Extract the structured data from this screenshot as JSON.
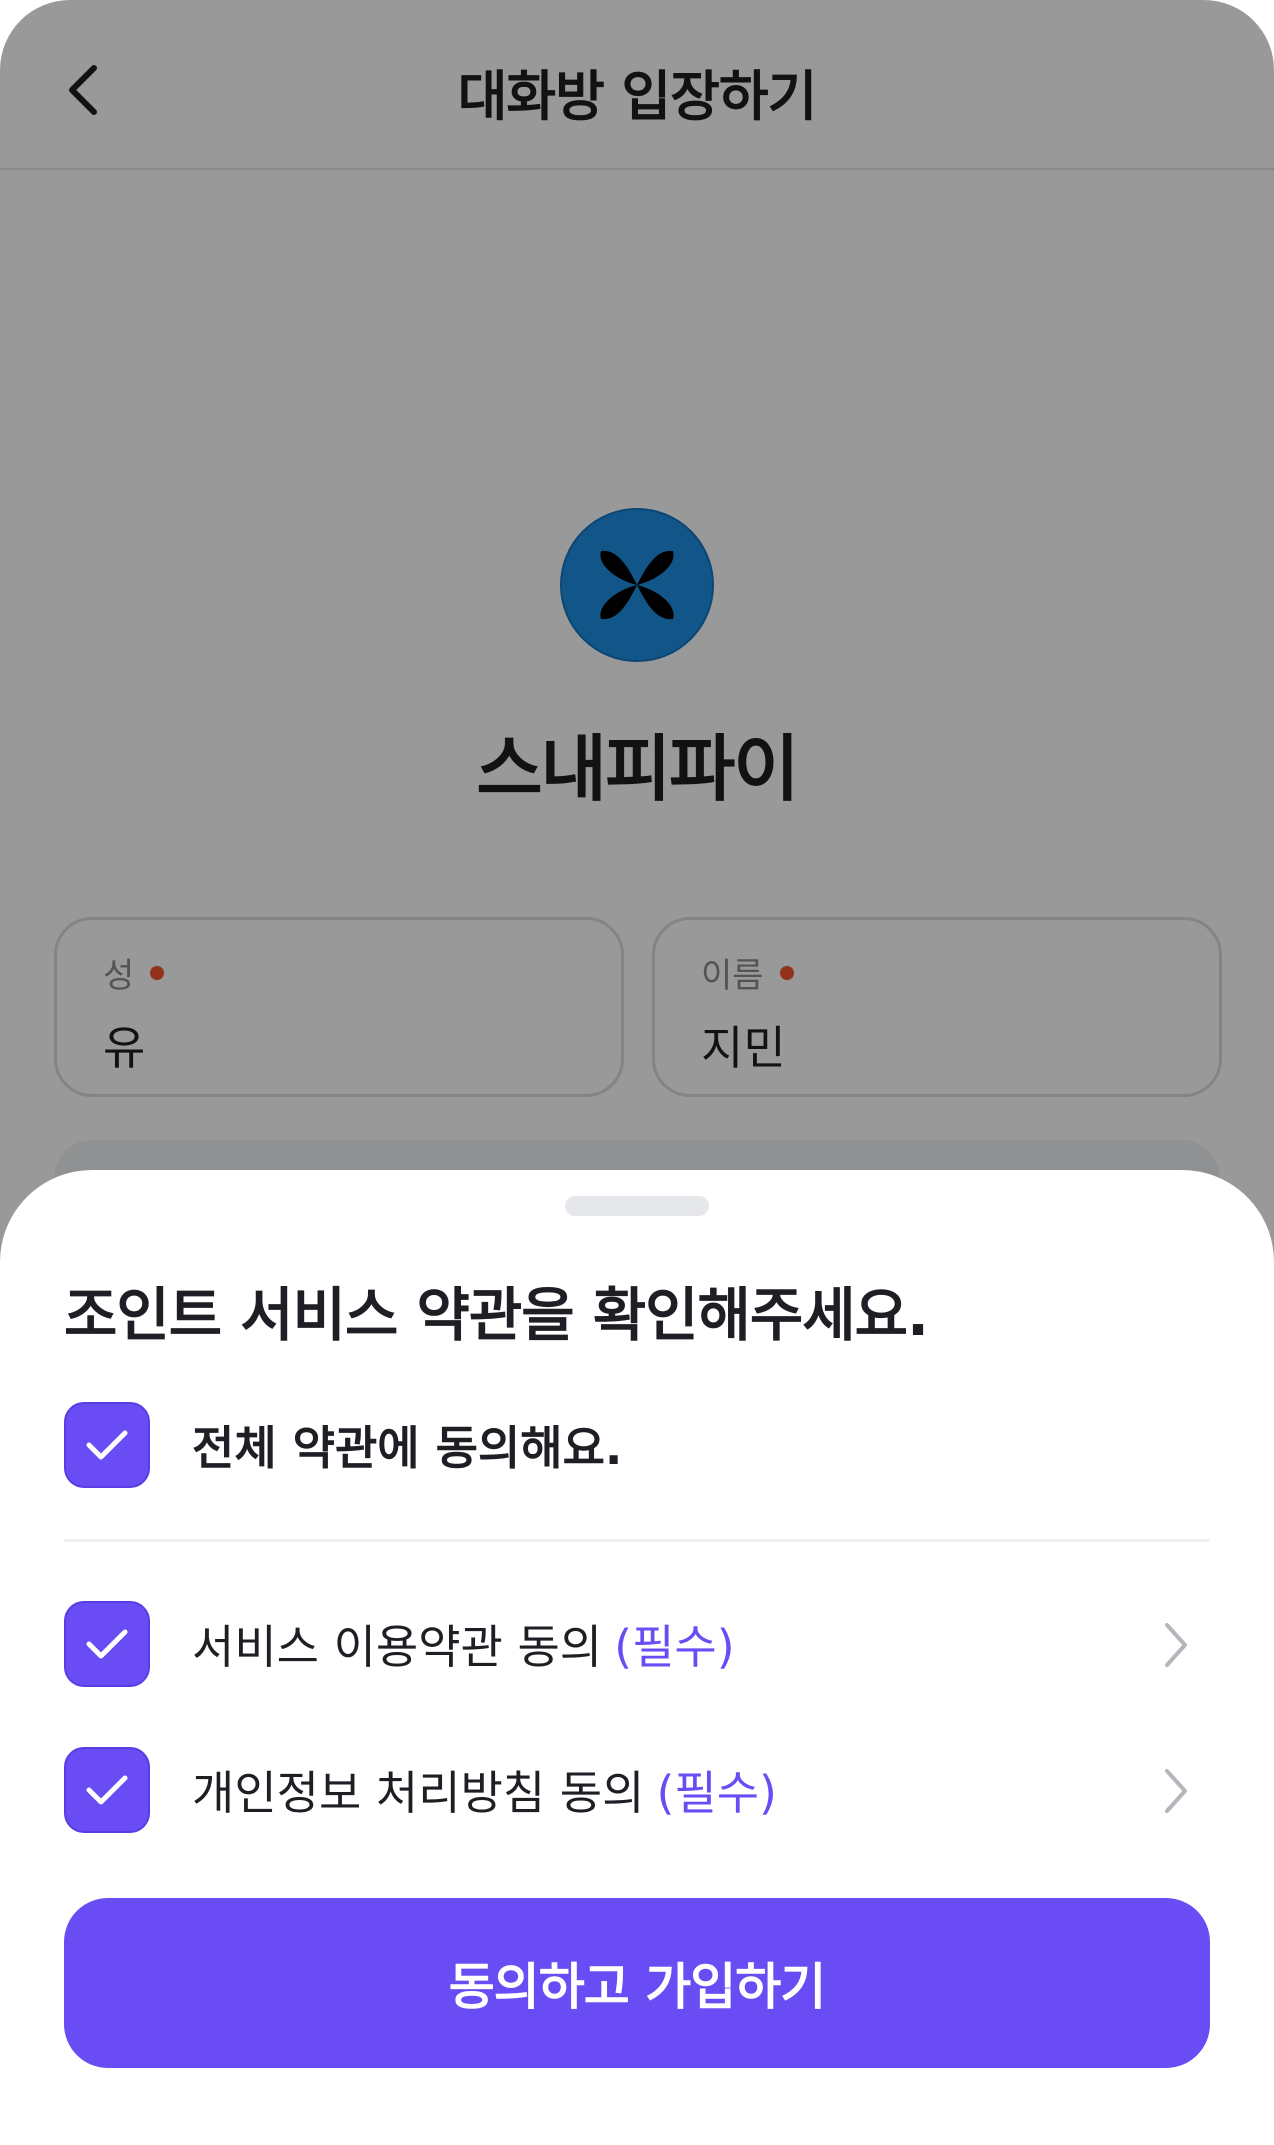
{
  "header": {
    "title": "대화방 입장하기",
    "back_icon": "chevron-left-icon"
  },
  "room": {
    "name": "스내피파이",
    "logo_icon": "butterfly-logo",
    "logo_color": "#1f8fe4"
  },
  "form": {
    "last_name": {
      "label": "성",
      "value": "유"
    },
    "first_name": {
      "label": "이름",
      "value": "지민"
    },
    "required_dot_color": "#f2552c"
  },
  "sheet": {
    "title": "조인트 서비스 약관을 확인해주세요.",
    "agree_all": {
      "label": "전체 약관에 동의해요.",
      "checked": true
    },
    "items": [
      {
        "label": "서비스 이용약관 동의",
        "tag": "(필수)",
        "checked": true
      },
      {
        "label": "개인정보 처리방침 동의",
        "tag": "(필수)",
        "checked": true
      }
    ],
    "submit_label": "동의하고 가입하기"
  },
  "colors": {
    "accent": "#6a4cf4",
    "text": "#1e1f24",
    "overlay": "rgba(0,0,0,0.40)"
  }
}
